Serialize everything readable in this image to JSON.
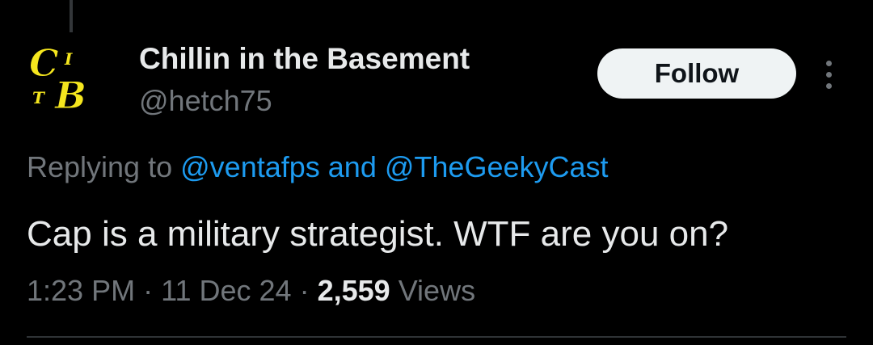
{
  "colors": {
    "background": "#000000",
    "text_primary": "#e7e9ea",
    "text_secondary": "#71767b",
    "link": "#1d9bf0",
    "follow_bg": "#eff3f4",
    "avatar_logo": "#f5e61e"
  },
  "author": {
    "display_name": "Chillin in the Basement",
    "handle": "@hetch75",
    "avatar_icon": "cib-blackletter-logo",
    "avatar_letters": [
      "C",
      "I",
      "T",
      "B"
    ]
  },
  "actions": {
    "follow_label": "Follow",
    "more_icon": "vertical-ellipsis-icon"
  },
  "reply": {
    "prefix": "Replying to",
    "mention_1": "@ventafps",
    "conjunction": "and",
    "mention_2": "@TheGeekyCast"
  },
  "tweet": {
    "text": "Cap is a military strategist. WTF are you on?"
  },
  "meta": {
    "time": "1:23 PM",
    "sep_1": "·",
    "date": "11 Dec 24",
    "sep_2": "·",
    "views_count": "2,559",
    "views_label": "Views"
  }
}
